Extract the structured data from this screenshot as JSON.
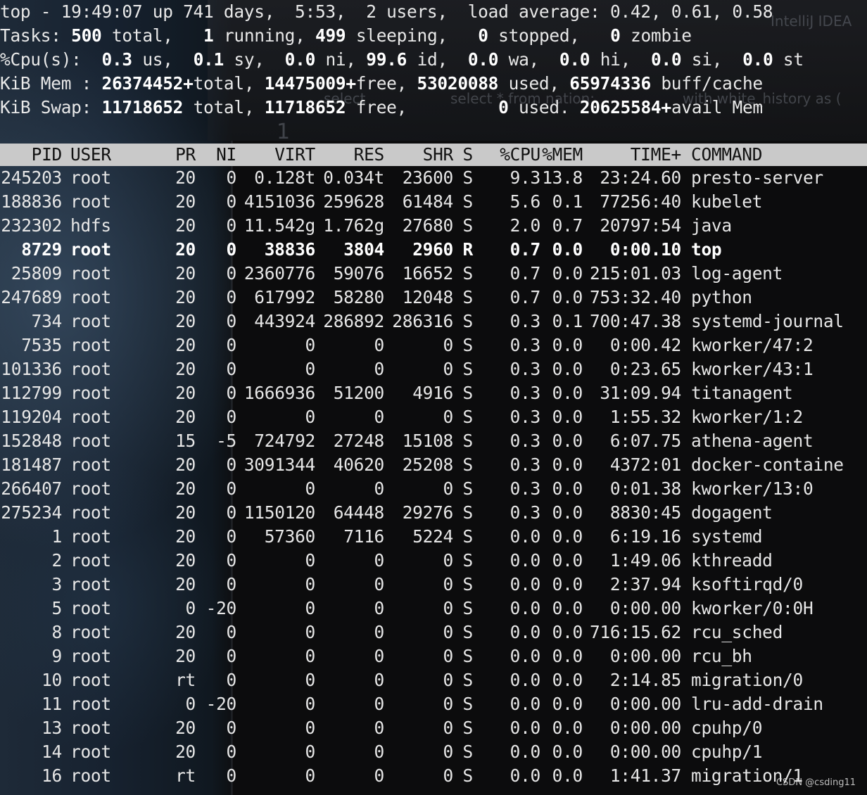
{
  "summary": {
    "line1": "top - 19:49:07 up 741 days,  5:53,  2 users,  load average: 0.42, 0.61, 0.58",
    "tasks": {
      "label": "Tasks:",
      "total": "500",
      "total_label": "total,",
      "running": "1",
      "running_label": "running,",
      "sleeping": "499",
      "sleeping_label": "sleeping,",
      "stopped": "0",
      "stopped_label": "stopped,",
      "zombie": "0",
      "zombie_label": "zombie"
    },
    "cpu": {
      "label": "%Cpu(s):",
      "us": "0.3",
      "us_label": "us,",
      "sy": "0.1",
      "sy_label": "sy,",
      "ni": "0.0",
      "ni_label": "ni,",
      "id": "99.6",
      "id_label": "id,",
      "wa": "0.0",
      "wa_label": "wa,",
      "hi": "0.0",
      "hi_label": "hi,",
      "si": "0.0",
      "si_label": "si,",
      "st": "0.0",
      "st_label": "st"
    },
    "mem": {
      "label": "KiB Mem :",
      "total": "26374452+",
      "total_label": "total,",
      "free": "14475009+",
      "free_label": "free,",
      "used": "53020088",
      "used_label": "used,",
      "buff": "65974336",
      "buff_label": "buff/cache"
    },
    "swap": {
      "label": "KiB Swap:",
      "total": "11718652",
      "total_label": "total,",
      "free": "11718652",
      "free_label": "free,",
      "used": "0",
      "used_label": "used.",
      "avail": "20625584+",
      "avail_label": "avail Mem"
    }
  },
  "background_window": {
    "tab_title": "IntelliJ IDEA",
    "tokens": [
      "select",
      "select * from nation;",
      "with white_history as ("
    ],
    "line_number": "1"
  },
  "columns": [
    "PID",
    "USER",
    "PR",
    "NI",
    "VIRT",
    "RES",
    "SHR",
    "S",
    "%CPU",
    "%MEM",
    "TIME+",
    "COMMAND"
  ],
  "processes": [
    {
      "pid": "245203",
      "user": "root",
      "pr": "20",
      "ni": "0",
      "virt": "0.128t",
      "res": "0.034t",
      "shr": "23600",
      "s": "S",
      "cpu": "9.3",
      "mem": "13.8",
      "time": "23:24.60",
      "cmd": "presto-server",
      "bold": false
    },
    {
      "pid": "188836",
      "user": "root",
      "pr": "20",
      "ni": "0",
      "virt": "4151036",
      "res": "259628",
      "shr": "61484",
      "s": "S",
      "cpu": "5.6",
      "mem": "0.1",
      "time": "77256:40",
      "cmd": "kubelet",
      "bold": false
    },
    {
      "pid": "232302",
      "user": "hdfs",
      "pr": "20",
      "ni": "0",
      "virt": "11.542g",
      "res": "1.762g",
      "shr": "27680",
      "s": "S",
      "cpu": "2.0",
      "mem": "0.7",
      "time": "20797:54",
      "cmd": "java",
      "bold": false
    },
    {
      "pid": "8729",
      "user": "root",
      "pr": "20",
      "ni": "0",
      "virt": "38836",
      "res": "3804",
      "shr": "2960",
      "s": "R",
      "cpu": "0.7",
      "mem": "0.0",
      "time": "0:00.10",
      "cmd": "top",
      "bold": true
    },
    {
      "pid": "25809",
      "user": "root",
      "pr": "20",
      "ni": "0",
      "virt": "2360776",
      "res": "59076",
      "shr": "16652",
      "s": "S",
      "cpu": "0.7",
      "mem": "0.0",
      "time": "215:01.03",
      "cmd": "log-agent",
      "bold": false
    },
    {
      "pid": "247689",
      "user": "root",
      "pr": "20",
      "ni": "0",
      "virt": "617992",
      "res": "58280",
      "shr": "12048",
      "s": "S",
      "cpu": "0.7",
      "mem": "0.0",
      "time": "753:32.40",
      "cmd": "python",
      "bold": false
    },
    {
      "pid": "734",
      "user": "root",
      "pr": "20",
      "ni": "0",
      "virt": "443924",
      "res": "286892",
      "shr": "286316",
      "s": "S",
      "cpu": "0.3",
      "mem": "0.1",
      "time": "700:47.38",
      "cmd": "systemd-journal",
      "bold": false
    },
    {
      "pid": "7535",
      "user": "root",
      "pr": "20",
      "ni": "0",
      "virt": "0",
      "res": "0",
      "shr": "0",
      "s": "S",
      "cpu": "0.3",
      "mem": "0.0",
      "time": "0:00.42",
      "cmd": "kworker/47:2",
      "bold": false
    },
    {
      "pid": "101336",
      "user": "root",
      "pr": "20",
      "ni": "0",
      "virt": "0",
      "res": "0",
      "shr": "0",
      "s": "S",
      "cpu": "0.3",
      "mem": "0.0",
      "time": "0:23.65",
      "cmd": "kworker/43:1",
      "bold": false
    },
    {
      "pid": "112799",
      "user": "root",
      "pr": "20",
      "ni": "0",
      "virt": "1666936",
      "res": "51200",
      "shr": "4916",
      "s": "S",
      "cpu": "0.3",
      "mem": "0.0",
      "time": "31:09.94",
      "cmd": "titanagent",
      "bold": false
    },
    {
      "pid": "119204",
      "user": "root",
      "pr": "20",
      "ni": "0",
      "virt": "0",
      "res": "0",
      "shr": "0",
      "s": "S",
      "cpu": "0.3",
      "mem": "0.0",
      "time": "1:55.32",
      "cmd": "kworker/1:2",
      "bold": false
    },
    {
      "pid": "152848",
      "user": "root",
      "pr": "15",
      "ni": "-5",
      "virt": "724792",
      "res": "27248",
      "shr": "15108",
      "s": "S",
      "cpu": "0.3",
      "mem": "0.0",
      "time": "6:07.75",
      "cmd": "athena-agent",
      "bold": false
    },
    {
      "pid": "181487",
      "user": "root",
      "pr": "20",
      "ni": "0",
      "virt": "3091344",
      "res": "40620",
      "shr": "25208",
      "s": "S",
      "cpu": "0.3",
      "mem": "0.0",
      "time": "4372:01",
      "cmd": "docker-containe",
      "bold": false
    },
    {
      "pid": "266407",
      "user": "root",
      "pr": "20",
      "ni": "0",
      "virt": "0",
      "res": "0",
      "shr": "0",
      "s": "S",
      "cpu": "0.3",
      "mem": "0.0",
      "time": "0:01.38",
      "cmd": "kworker/13:0",
      "bold": false
    },
    {
      "pid": "275234",
      "user": "root",
      "pr": "20",
      "ni": "0",
      "virt": "1150120",
      "res": "64448",
      "shr": "29276",
      "s": "S",
      "cpu": "0.3",
      "mem": "0.0",
      "time": "8830:45",
      "cmd": "dogagent",
      "bold": false
    },
    {
      "pid": "1",
      "user": "root",
      "pr": "20",
      "ni": "0",
      "virt": "57360",
      "res": "7116",
      "shr": "5224",
      "s": "S",
      "cpu": "0.0",
      "mem": "0.0",
      "time": "6:19.16",
      "cmd": "systemd",
      "bold": false
    },
    {
      "pid": "2",
      "user": "root",
      "pr": "20",
      "ni": "0",
      "virt": "0",
      "res": "0",
      "shr": "0",
      "s": "S",
      "cpu": "0.0",
      "mem": "0.0",
      "time": "1:49.06",
      "cmd": "kthreadd",
      "bold": false
    },
    {
      "pid": "3",
      "user": "root",
      "pr": "20",
      "ni": "0",
      "virt": "0",
      "res": "0",
      "shr": "0",
      "s": "S",
      "cpu": "0.0",
      "mem": "0.0",
      "time": "2:37.94",
      "cmd": "ksoftirqd/0",
      "bold": false
    },
    {
      "pid": "5",
      "user": "root",
      "pr": "0",
      "ni": "-20",
      "virt": "0",
      "res": "0",
      "shr": "0",
      "s": "S",
      "cpu": "0.0",
      "mem": "0.0",
      "time": "0:00.00",
      "cmd": "kworker/0:0H",
      "bold": false
    },
    {
      "pid": "8",
      "user": "root",
      "pr": "20",
      "ni": "0",
      "virt": "0",
      "res": "0",
      "shr": "0",
      "s": "S",
      "cpu": "0.0",
      "mem": "0.0",
      "time": "716:15.62",
      "cmd": "rcu_sched",
      "bold": false
    },
    {
      "pid": "9",
      "user": "root",
      "pr": "20",
      "ni": "0",
      "virt": "0",
      "res": "0",
      "shr": "0",
      "s": "S",
      "cpu": "0.0",
      "mem": "0.0",
      "time": "0:00.00",
      "cmd": "rcu_bh",
      "bold": false
    },
    {
      "pid": "10",
      "user": "root",
      "pr": "rt",
      "ni": "0",
      "virt": "0",
      "res": "0",
      "shr": "0",
      "s": "S",
      "cpu": "0.0",
      "mem": "0.0",
      "time": "2:14.85",
      "cmd": "migration/0",
      "bold": false
    },
    {
      "pid": "11",
      "user": "root",
      "pr": "0",
      "ni": "-20",
      "virt": "0",
      "res": "0",
      "shr": "0",
      "s": "S",
      "cpu": "0.0",
      "mem": "0.0",
      "time": "0:00.00",
      "cmd": "lru-add-drain",
      "bold": false
    },
    {
      "pid": "13",
      "user": "root",
      "pr": "20",
      "ni": "0",
      "virt": "0",
      "res": "0",
      "shr": "0",
      "s": "S",
      "cpu": "0.0",
      "mem": "0.0",
      "time": "0:00.00",
      "cmd": "cpuhp/0",
      "bold": false
    },
    {
      "pid": "14",
      "user": "root",
      "pr": "20",
      "ni": "0",
      "virt": "0",
      "res": "0",
      "shr": "0",
      "s": "S",
      "cpu": "0.0",
      "mem": "0.0",
      "time": "0:00.00",
      "cmd": "cpuhp/1",
      "bold": false
    },
    {
      "pid": "16",
      "user": "root",
      "pr": "rt",
      "ni": "0",
      "virt": "0",
      "res": "0",
      "shr": "0",
      "s": "S",
      "cpu": "0.0",
      "mem": "0.0",
      "time": "1:41.37",
      "cmd": "migration/1",
      "bold": false
    }
  ],
  "watermark": "CSDN @csding11",
  "colors": {
    "header_bg": "#c9c9c9",
    "header_fg": "#111111",
    "text": "#e6e6e6",
    "bold_text": "#ffffff",
    "terminal_bg": "#0c0c0d"
  }
}
